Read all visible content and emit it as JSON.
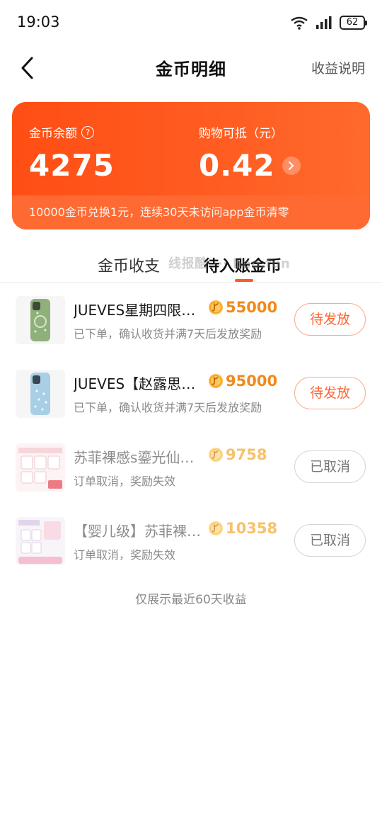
{
  "status_bar": {
    "time": "19:03",
    "battery": "62",
    "wifi_badge": "6"
  },
  "nav": {
    "title": "金币明细",
    "action": "收益说明"
  },
  "balance": {
    "coin_label": "金币余额",
    "coin_value": "4275",
    "cash_label": "购物可抵（元）",
    "cash_value": "0.42",
    "note": "10000金币兑换1元，连续30天未访问app金币清零"
  },
  "tabs": [
    {
      "label": "金币收支",
      "active": false
    },
    {
      "label": "待入账金币",
      "active": true
    }
  ],
  "watermark": "线报酷 ··· bao.fun",
  "orders": [
    {
      "title": "JUEVES星期四限定款",
      "coins": "55000",
      "desc": "已下单，确认收货并满7天后发放奖励",
      "status": "待发放",
      "state": "pending",
      "thumb_color": "#8fb07a"
    },
    {
      "title": "JUEVES【赵露思同款】",
      "coins": "95000",
      "desc": "已下单，确认收货并满7天后发放奖励",
      "status": "待发放",
      "state": "pending",
      "thumb_color": "#9cc6e0"
    },
    {
      "title": "苏菲裸感s鎏光仙女卫生巾",
      "coins": "9758",
      "desc": "订单取消，奖励失效",
      "status": "已取消",
      "state": "cancelled",
      "thumb_color": "#f4c9cf"
    },
    {
      "title": "【婴儿级】苏菲裸感卫生巾",
      "coins": "10358",
      "desc": "订单取消，奖励失效",
      "status": "已取消",
      "state": "cancelled",
      "thumb_color": "#f2c3d4"
    }
  ],
  "footer_note": "仅展示最近60天收益",
  "colors": {
    "accent": "#ff5a1f",
    "coin": "#f08a1c",
    "pending_text": "#ff6633"
  }
}
